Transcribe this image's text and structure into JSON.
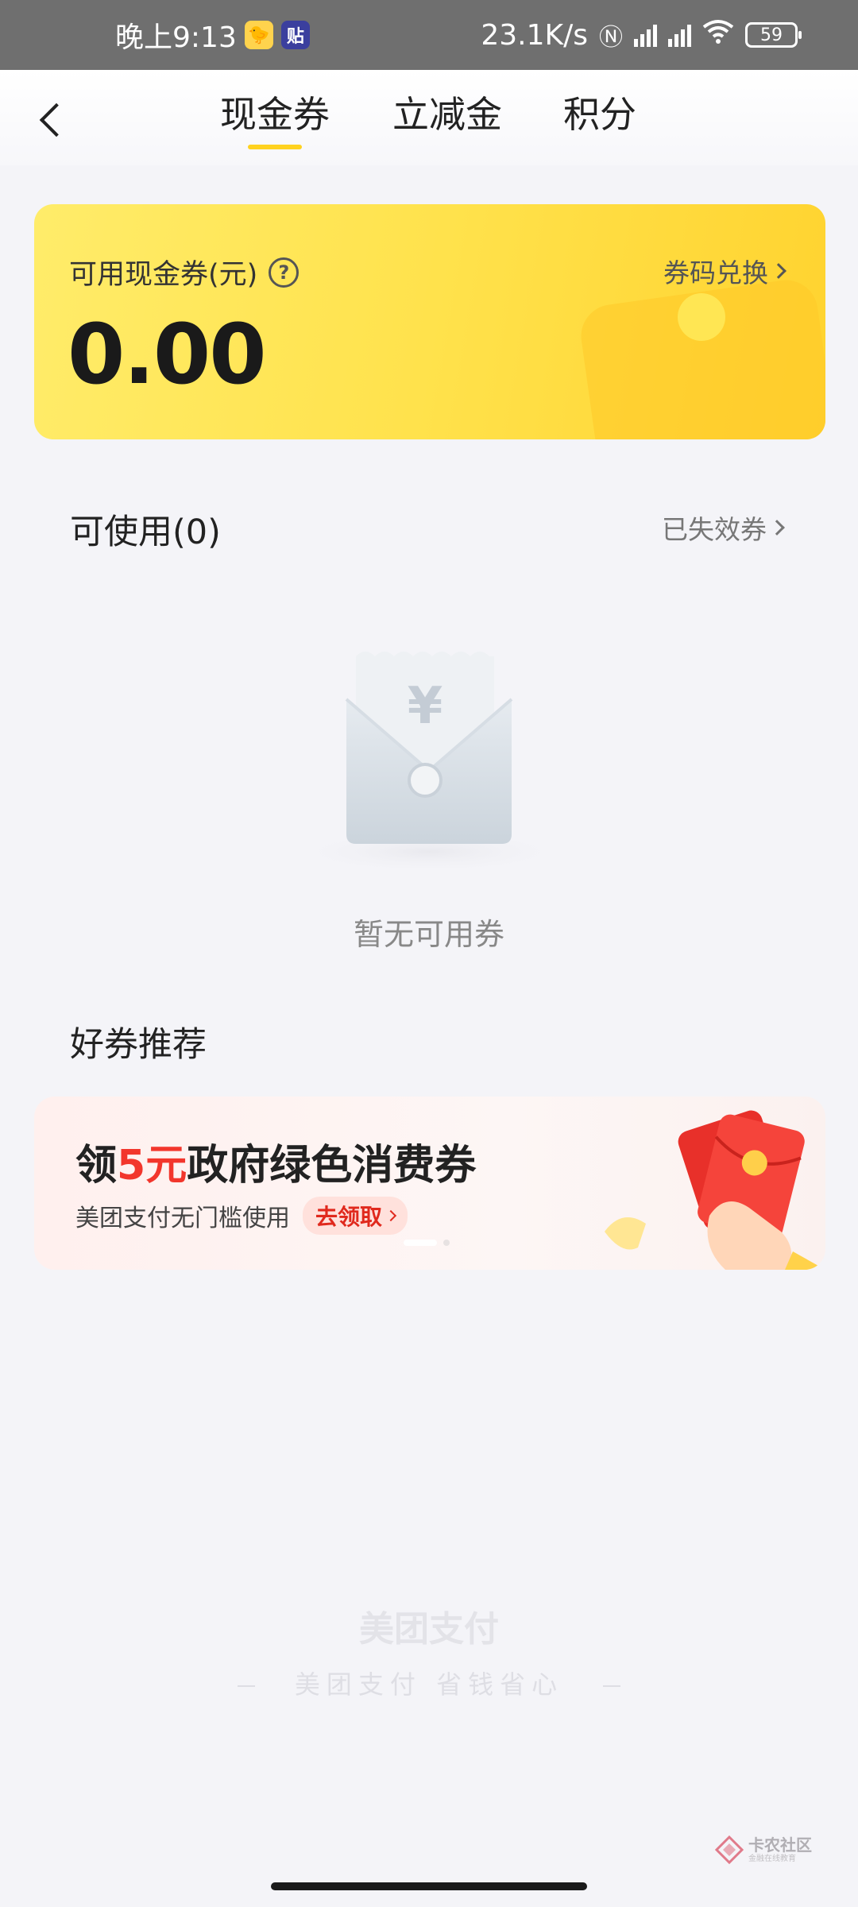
{
  "status_bar": {
    "time": "晚上9:13",
    "app_icon_a": "🐤",
    "app_icon_b": "贴",
    "net_speed": "23.1K/s",
    "battery": "59"
  },
  "header": {
    "tabs": [
      {
        "label": "现金券",
        "active": true
      },
      {
        "label": "立减金",
        "active": false
      },
      {
        "label": "积分",
        "active": false
      }
    ]
  },
  "balance_card": {
    "label": "可用现金券(元)",
    "amount": "0.00",
    "exchange_link": "券码兑换"
  },
  "available": {
    "title": "可使用(0)",
    "expired_link": "已失效券",
    "empty_text": "暂无可用券"
  },
  "recommended": {
    "title": "好券推荐",
    "banner": {
      "headline_prefix": "领",
      "headline_highlight": "5元",
      "headline_suffix": "政府绿色消费券",
      "subtitle": "美团支付无门槛使用",
      "cta": "去领取"
    }
  },
  "footer": {
    "brand": "美团支付",
    "slogan": "美团支付 省钱省心"
  },
  "watermark": {
    "main": "卡农社区",
    "sub": "金融在线教育"
  },
  "colors": {
    "accent_yellow": "#ffd21f",
    "highlight_red": "#f2362c",
    "background": "#f4f4f8"
  }
}
